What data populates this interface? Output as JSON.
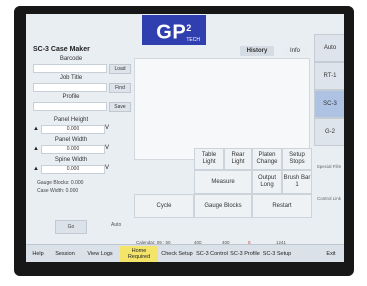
{
  "logo": {
    "text": "GP",
    "superscript": "2",
    "sub": "TECH"
  },
  "left": {
    "title": "SC-3 Case Maker",
    "barcode_label": "Barcode",
    "barcode_btn": "Load",
    "jobtitle_label": "Job Title",
    "jobtitle_btn": "Find",
    "profile_label": "Profile",
    "profile_btn": "Save",
    "panel_height_label": "Panel Height",
    "panel_height_value": "0.000",
    "panel_width_label": "Panel Width",
    "panel_width_value": "0.000",
    "spine_width_label": "Spine Width",
    "spine_width_value": "0.000",
    "unit": "V",
    "gauge_blocks": "Gauge Blocks: 0.000",
    "case_width": "Case Width: 0.000",
    "go_btn": "Go",
    "auto_btn": "Auto"
  },
  "tabs": {
    "history": "History",
    "info": "Info"
  },
  "grid": {
    "table_light": "Table Light",
    "rear_light": "Rear Light",
    "platen_change": "Platen Change",
    "setup_stops": "Setup Stops",
    "measure": "Measure",
    "output_long": "Output Long",
    "brush_bar": "Brush Bar 1",
    "cycle": "Cycle",
    "gauge_blocks": "Gauge Blocks",
    "restart": "Restart"
  },
  "right": {
    "auto": "Auto",
    "rt1": "RT-1",
    "sc3": "SC-3",
    "g2": "G-2",
    "small1": "Special Film",
    "small2": "Control Link"
  },
  "status": {
    "calendar": "Calendar: 09 : 50",
    "v1": "400",
    "v2": "400",
    "v3": "0",
    "v4": "1241"
  },
  "bottom": {
    "help": "Help",
    "session": "Session",
    "view_logs": "View Logs",
    "home_required": "Home Required",
    "check_setup": "Check Setup",
    "sc3_control": "SC-3 Control",
    "sc3_profile": "SC-3 Profile",
    "sc3_setup": "SC-3 Setup",
    "exit": "Exit"
  }
}
